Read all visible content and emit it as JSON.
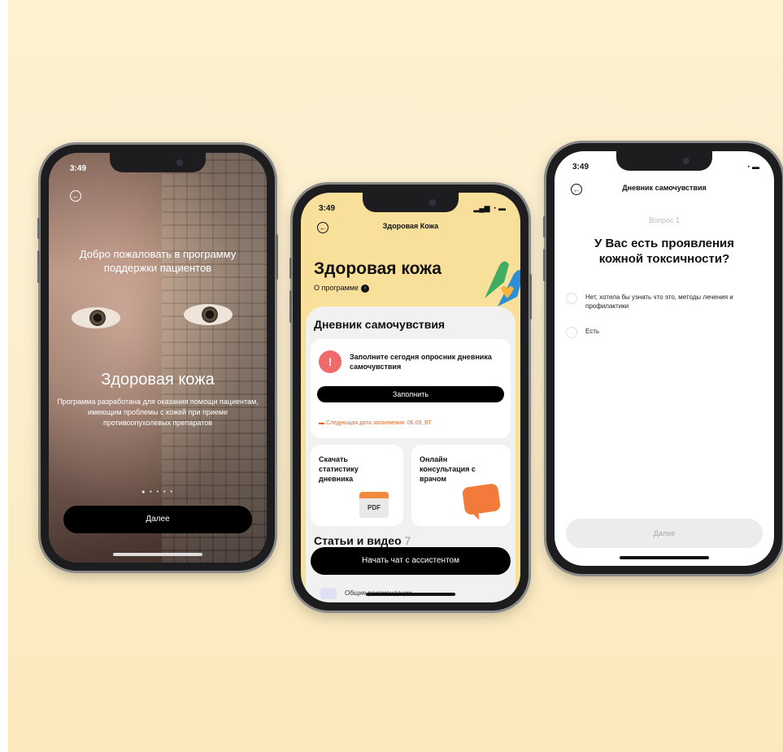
{
  "phone1": {
    "status_time": "3:49",
    "welcome_title": "Добро пожаловать в программу поддержки пациентов",
    "brand": "Здоровая кожа",
    "description": "Программа разработана для оказания помощи пациентам, имеющим проблемы с кожей при приеме противоопухолевых препаратов",
    "pager_dots": "● • • • •",
    "next_button": "Далее"
  },
  "phone2": {
    "status_time": "3:49",
    "nav_title": "Здоровая Кожа",
    "brand": "Здоровая кожа",
    "about_link": "О программе",
    "diary_heading": "Дневник самочувствия",
    "diary_card": {
      "prompt": "Заполните сегодня опросник дневника самочувствия",
      "button": "Заполнить",
      "next_date": "Следующая дата заполнения: 06.09, ВТ"
    },
    "download_card": {
      "label": "Скачать статистику дневника",
      "badge": "PDF"
    },
    "consult_card": {
      "label": "Онлайн консультация с врачом"
    },
    "articles_heading": "Статьи и видео",
    "articles_count": "7",
    "chat_button": "Начать чат с ассистентом",
    "article_item": "Общие рекомендации"
  },
  "phone3": {
    "status_time": "3:49",
    "nav_title": "Дневник самочувствия",
    "question_number": "Вопрос 1",
    "question": "У Вас есть проявления кожной токсичности?",
    "options": [
      "Нет, хотела бы узнать что это, методы лечения и профилактики",
      "Есть"
    ],
    "next_button": "Далее"
  },
  "colors": {
    "background": "#fcefd0",
    "accent_orange": "#f27a3a",
    "warning_red": "#ef6b6b",
    "phone2_header": "#f8df9a"
  }
}
